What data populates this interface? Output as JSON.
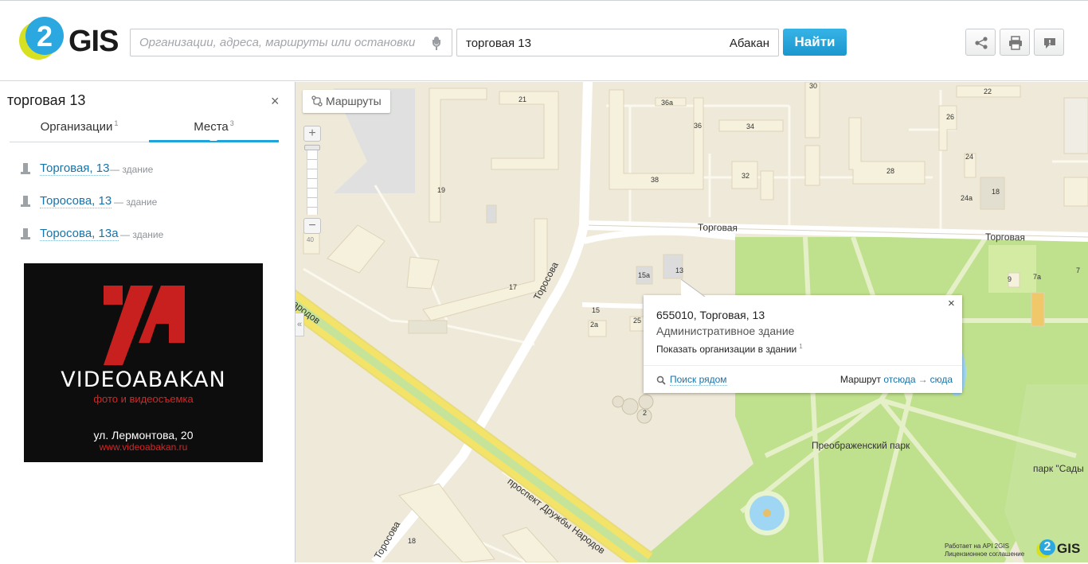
{
  "header": {
    "logo": {
      "mark": "2",
      "text": "GIS"
    },
    "search": {
      "placeholder": "Организации, адреса, маршруты или остановки",
      "value": ""
    },
    "where": {
      "query": "торговая 13",
      "city": "Абакан"
    },
    "find_label": "Найти",
    "tools": {
      "share_icon": "share-icon",
      "print_icon": "printer-icon",
      "feedback_icon": "speech-bubble-icon"
    }
  },
  "sidebar": {
    "title": "торговая 13",
    "close": "×",
    "tabs": [
      {
        "label": "Организации",
        "count": "1"
      },
      {
        "label": "Места",
        "count": "3"
      }
    ],
    "places": [
      {
        "name": "Торговая, 13",
        "kind": "— здание"
      },
      {
        "name": "Торосова, 13",
        "kind": "— здание"
      },
      {
        "name": "Торосова, 13а",
        "kind": "— здание"
      }
    ],
    "ad": {
      "name": "VIDEOABAKAN",
      "tagline": "фото и видеосъемка",
      "address": "ул. Лермонтова, 20",
      "url": "www.videoabakan.ru",
      "accent": "#c8201f"
    }
  },
  "map": {
    "routes_label": "Маршруты",
    "zoom": {
      "in": "+",
      "out": "−",
      "level_label": "40"
    },
    "collapse": "«",
    "streets": {
      "torgovaya_1": "Торговая",
      "torgovaya_2": "Торговая",
      "torosova_1": "Торосова",
      "torosova_2": "Торосова",
      "druzhby": "проспект Дружбы Народов",
      "narodov_fragment": "ародов"
    },
    "places": {
      "park": "Преображенский парк",
      "park2": "парк \"Сады"
    },
    "house_numbers": {
      "h21": "21",
      "h19": "19",
      "h17": "17",
      "h36a": "36а",
      "h36": "36",
      "h38": "38",
      "h34": "34",
      "h32": "32",
      "h30": "30",
      "h22": "22",
      "h26": "26",
      "h24": "24",
      "h24a": "24а",
      "h28": "28",
      "h18": "18",
      "h15a": "15а",
      "h13": "13",
      "h15": "15",
      "h2a": "2а",
      "h25": "25",
      "h2": "2",
      "h9": "9",
      "h7a": "7а",
      "h7": "7",
      "h18b": "18"
    },
    "popup": {
      "address": "655010, Торговая, 13",
      "type": "Административное здание",
      "orgs_link": "Показать организации в здании",
      "orgs_count": "1",
      "close": "×",
      "nearby": "Поиск рядом",
      "route_prefix": "Маршрут",
      "route_from": "отсюда",
      "route_arrow": "→",
      "route_to": "сюда"
    },
    "attribution": {
      "line1": "Работает на API 2GIS",
      "line2": "Лицензионное соглашение"
    },
    "logo": {
      "mark": "2",
      "text": "GIS"
    },
    "colors": {
      "land": "#efe9d9",
      "building": "#f6f1dc",
      "park": "#bfe08c",
      "road_major": "#f3e368",
      "water": "#9fd6f4",
      "link": "#1873a8",
      "accent": "#21a3d9"
    }
  }
}
